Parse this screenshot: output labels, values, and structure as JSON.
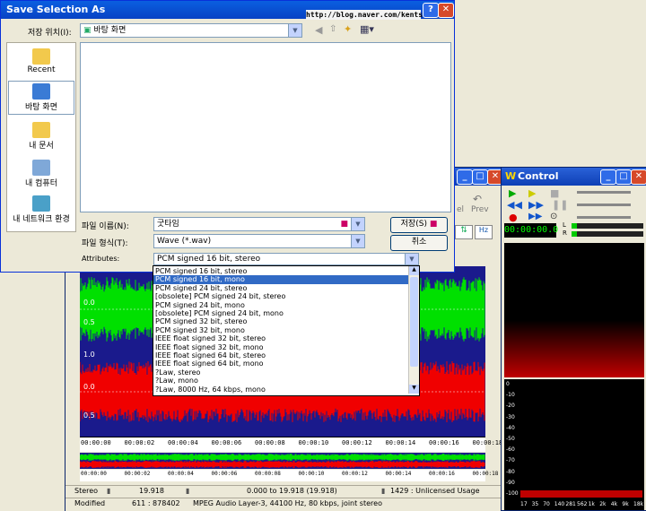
{
  "editor": {
    "wave_labels": [
      "0.0",
      "0.5",
      "1.0",
      "0.0",
      "0.5"
    ],
    "ruler_ticks": [
      "00:00:00",
      "00:00:02",
      "00:00:04",
      "00:00:06",
      "00:00:08",
      "00:00:10",
      "00:00:12",
      "00:00:14",
      "00:00:16",
      "00:00:18"
    ],
    "toolbar_labels": [
      "el",
      "Prev"
    ],
    "status_row1": {
      "mode": "Stereo",
      "length": "19.918",
      "range": "0.000 to 19.918 (19.918)",
      "usage": "1429 : Unlicensed Usage"
    },
    "status_row2": {
      "state": "Modified",
      "count": "611 : 878402",
      "format": "MPEG Audio Layer-3, 44100 Hz, 80 kbps, joint stereo"
    },
    "colors": {
      "wave_top": "#00E000",
      "wave_bottom": "#F00000",
      "background": "#1A1A8C"
    }
  },
  "control": {
    "title": "Control",
    "title_icon": "W",
    "timer": "00:00:00.0",
    "lr": [
      "L",
      "R"
    ],
    "meter_labels": [
      "0",
      "-10",
      "-20",
      "-30",
      "-40",
      "-50",
      "-60",
      "-70",
      "-80",
      "-90",
      "-100"
    ],
    "freq_labels": [
      "17",
      "35",
      "70",
      "140",
      "281",
      "562",
      "1k",
      "2k",
      "4k",
      "9k",
      "18k"
    ]
  },
  "dialog": {
    "title": "Save Selection As",
    "url_tag": "http://blog.naver.com/kentsh2",
    "location_label": "저장 위치(I):",
    "location_value": "바탕 화면",
    "places": [
      {
        "label": "Recent",
        "icon": "recent-folder-icon"
      },
      {
        "label": "바탕 화면",
        "icon": "desktop-icon"
      },
      {
        "label": "내 문서",
        "icon": "my-documents-icon"
      },
      {
        "label": "내 컴퓨터",
        "icon": "my-computer-icon"
      },
      {
        "label": "내 네트워크 환경",
        "icon": "network-icon"
      }
    ],
    "filename_label": "파일 이름(N):",
    "filename_value": "굿타임",
    "filetype_label": "파일 형식(T):",
    "filetype_value": "Wave (*.wav)",
    "attributes_label": "Attributes:",
    "attributes_value": "PCM signed 16 bit, stereo",
    "save_label": "저장(S)",
    "cancel_label": "취소",
    "attribute_options": [
      "PCM signed 16 bit, stereo",
      "PCM signed 16 bit, mono",
      "PCM signed 24 bit, stereo",
      "[obsolete] PCM signed 24 bit, stereo",
      "PCM signed 24 bit, mono",
      "[obsolete] PCM signed 24 bit, mono",
      "PCM signed 32 bit, stereo",
      "PCM signed 32 bit, mono",
      "IEEE float signed 32 bit, stereo",
      "IEEE float signed 32 bit, mono",
      "IEEE float signed 64 bit, stereo",
      "IEEE float signed 64 bit, mono",
      "?Law, stereo",
      "?Law, mono",
      "?Law, 8000 Hz, 64 kbps, mono"
    ],
    "selected_option_index": 1
  }
}
